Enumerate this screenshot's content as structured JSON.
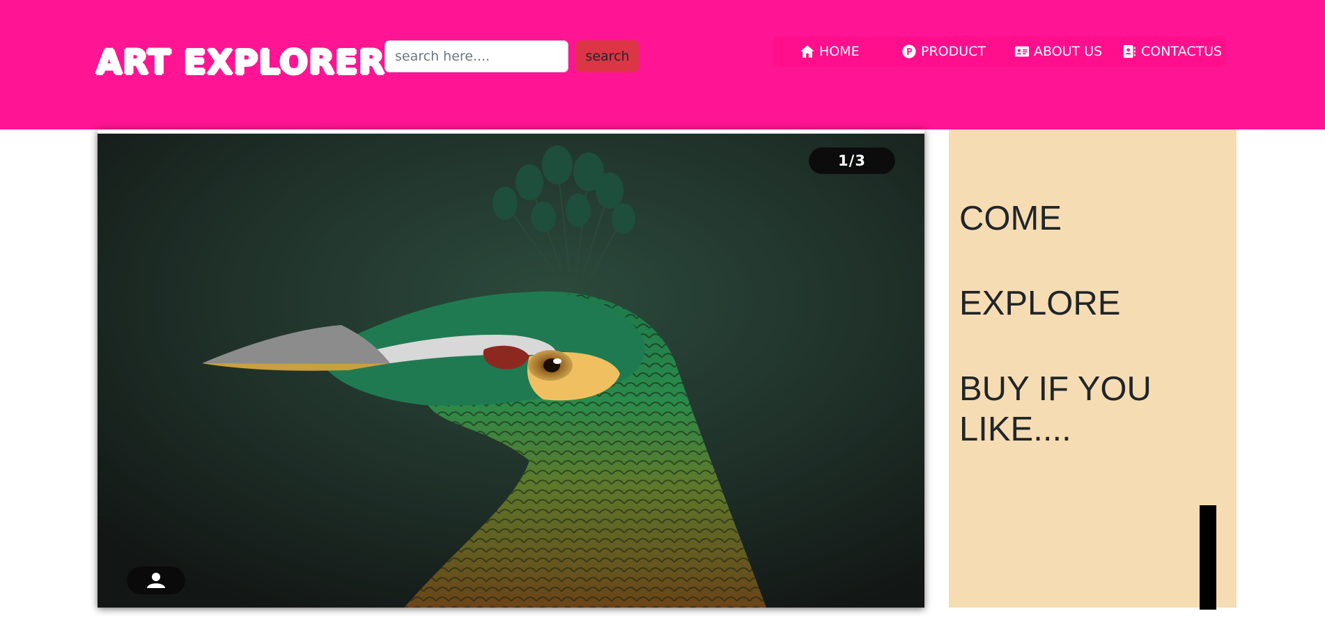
{
  "header": {
    "logo": "ART EXPLORER",
    "search": {
      "placeholder": "search here....",
      "button_label": "search"
    },
    "nav": [
      {
        "label": "HOME",
        "icon": "home-icon"
      },
      {
        "label": "PRODUCT",
        "icon": "product-p-icon"
      },
      {
        "label": "ABOUT US",
        "icon": "address-card-icon"
      },
      {
        "label": "CONTACTUS",
        "icon": "contact-book-icon"
      }
    ]
  },
  "slider": {
    "counter": "1/3",
    "image": "peacock-painting",
    "user_icon": "user-icon"
  },
  "side_panel": {
    "lines": [
      "COME",
      "EXPLORE",
      "BUY IF YOU",
      "LIKE...."
    ]
  },
  "colors": {
    "header_bg": "#ff1493",
    "search_button_bg": "#dc3545",
    "side_panel_bg": "#f5dcb3",
    "text_dark": "#212529"
  }
}
